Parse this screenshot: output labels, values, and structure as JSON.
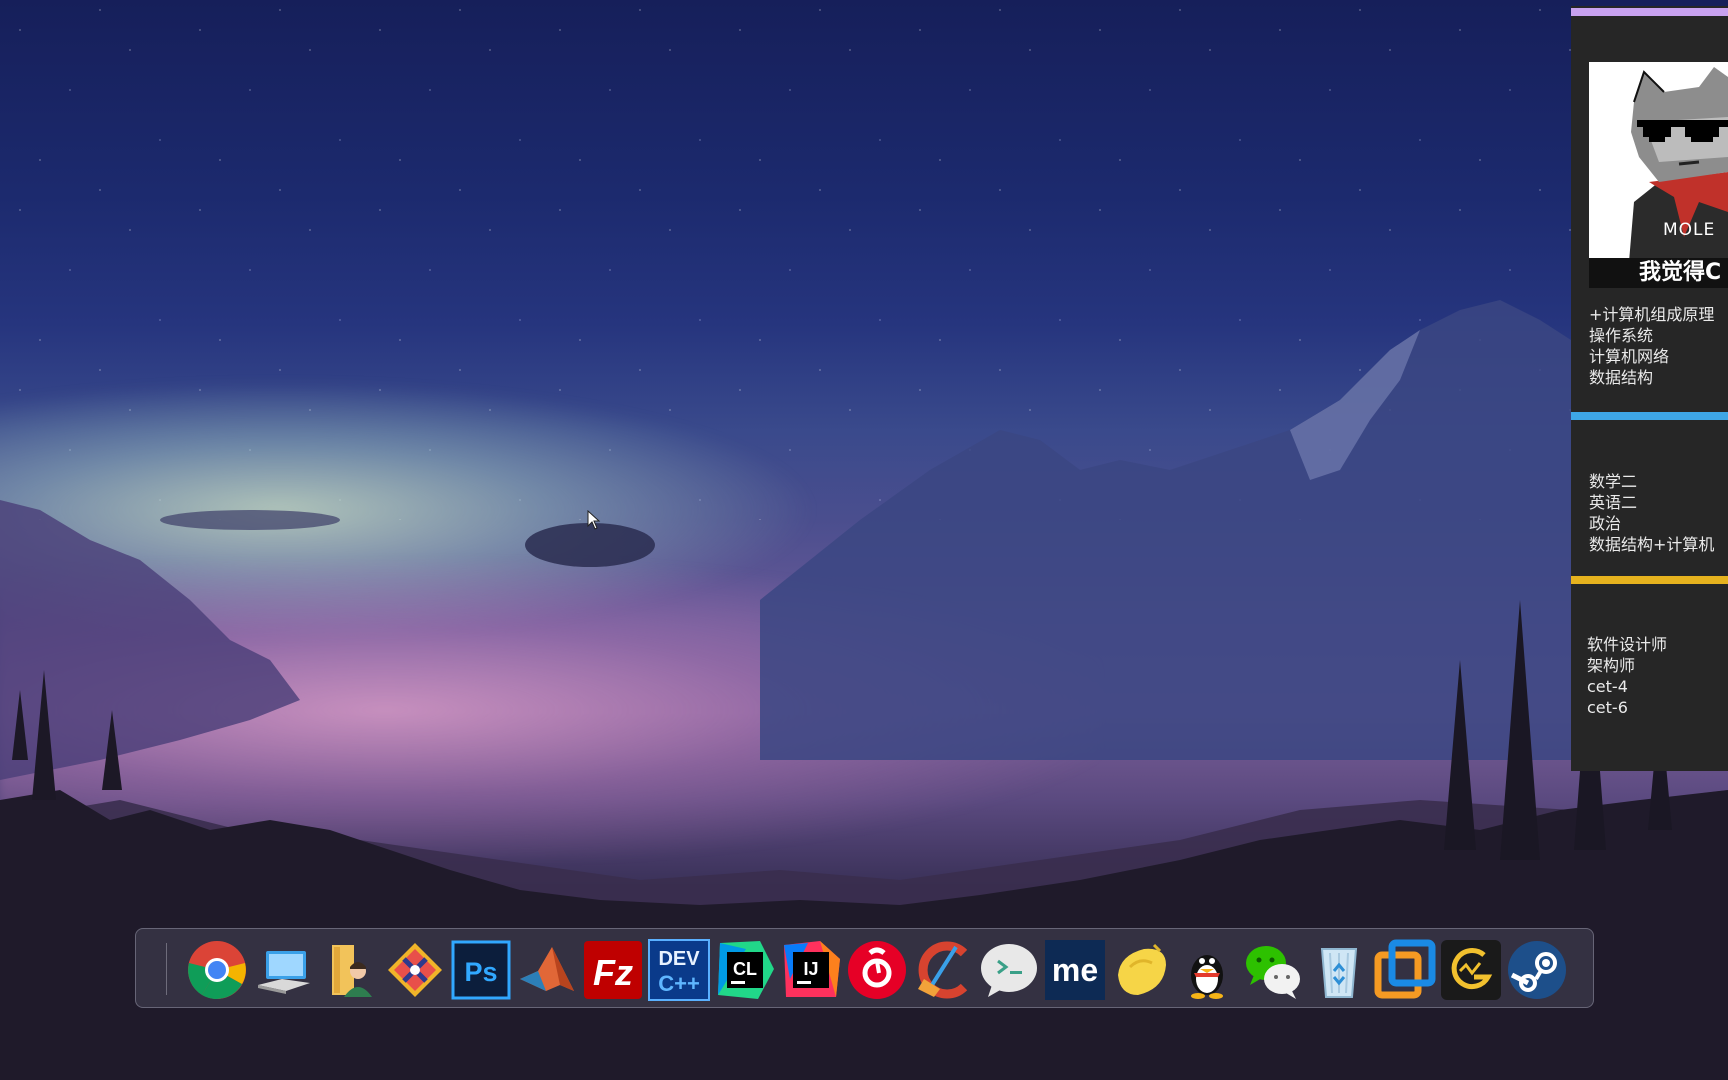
{
  "desktop": {
    "cursor": "arrow-cursor-icon"
  },
  "widget": {
    "avatar": {
      "shirt_text": "MOLE",
      "caption": "我觉得C"
    },
    "note1": {
      "items": [
        "+计算机组成原理",
        "操作系统",
        "计算机网络",
        "数据结构"
      ]
    },
    "note2": {
      "items": [
        "数学二",
        "英语二",
        "政治",
        "数据结构+计算机"
      ]
    },
    "note3": {
      "items": [
        "软件设计师",
        "架构师",
        "cet-4",
        "cet-6"
      ]
    },
    "colors": {
      "note1_bar": "#c9a2f0",
      "note2_bar": "#3ea6e6",
      "note3_bar": "#e6b21e",
      "background": "#262626"
    }
  },
  "dock": {
    "icons": [
      "chrome-icon",
      "this-pc-icon",
      "user-folder-icon",
      "git-icon",
      "photoshop-icon",
      "matlab-icon",
      "filezilla-icon",
      "dev-cpp-icon",
      "clion-icon",
      "intellij-idea-icon",
      "netease-music-icon",
      "ccleaner-icon",
      "chat-terminal-icon",
      "me-app-icon",
      "yellow-bird-icon",
      "qq-icon",
      "wechat-icon",
      "recycle-bin-icon",
      "vmware-icon",
      "grapher-icon",
      "steam-icon"
    ],
    "labels": {
      "photoshop": "Ps",
      "filezilla": "Fz",
      "devcpp_top": "DEV",
      "devcpp_bottom": "C++",
      "clion": "CL",
      "idea": "IJ",
      "me": "me"
    }
  }
}
